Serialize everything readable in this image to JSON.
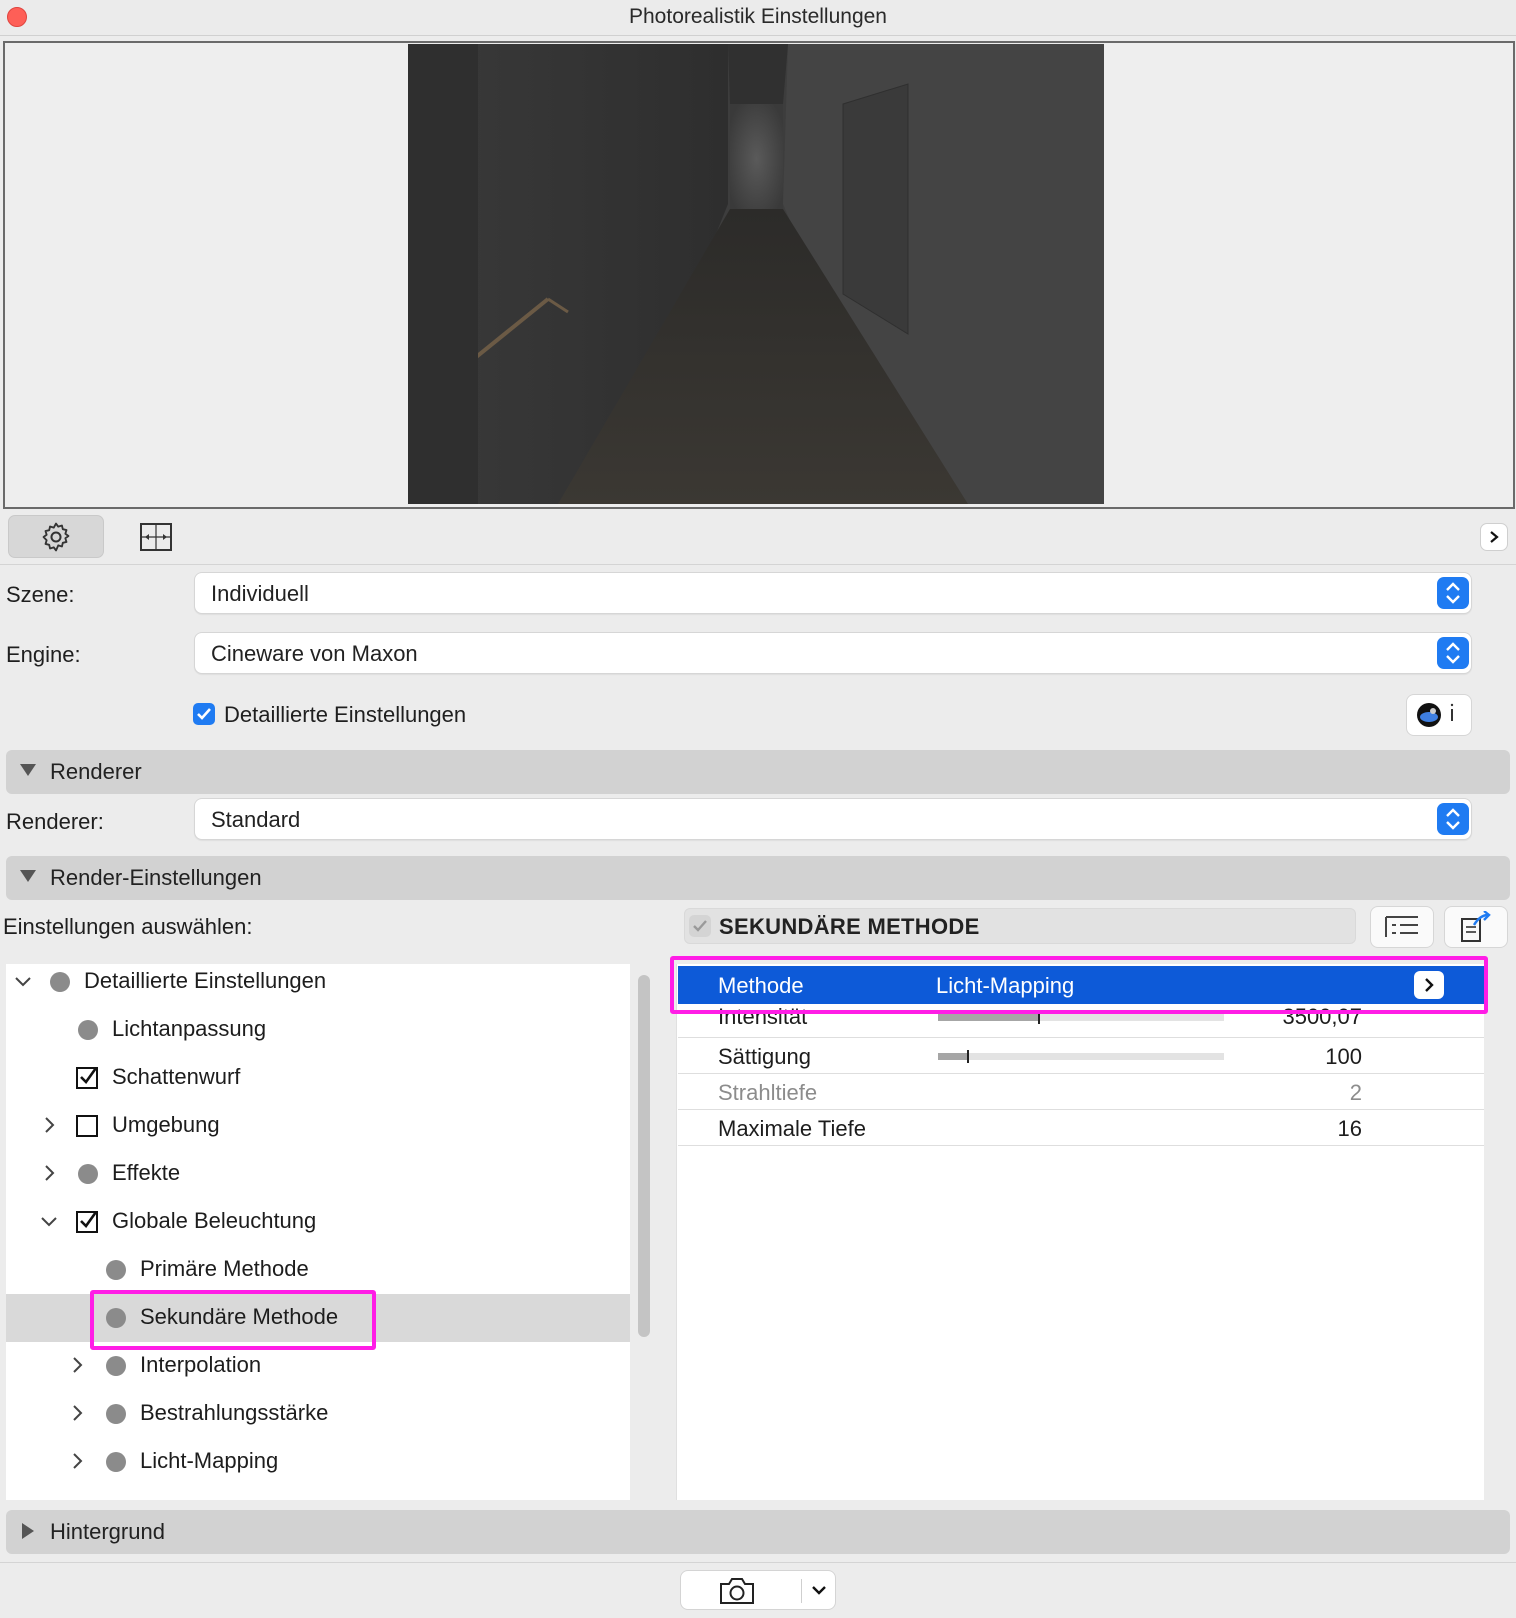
{
  "window": {
    "title": "Photorealistik Einstellungen"
  },
  "form": {
    "szene_label": "Szene:",
    "szene_value": "Individuell",
    "engine_label": "Engine:",
    "engine_value": "Cineware von Maxon",
    "detailed_label": "Detaillierte Einstellungen",
    "renderer_label": "Renderer:",
    "renderer_value": "Standard"
  },
  "sections": {
    "renderer": "Renderer",
    "render_settings": "Render-Einstellungen",
    "background": "Hintergrund"
  },
  "settings": {
    "select_label": "Einstellungen auswählen:"
  },
  "tree": {
    "items": [
      {
        "label": "Detaillierte Einstellungen"
      },
      {
        "label": "Lichtanpassung"
      },
      {
        "label": "Schattenwurf"
      },
      {
        "label": "Umgebung"
      },
      {
        "label": "Effekte"
      },
      {
        "label": "Globale Beleuchtung"
      },
      {
        "label": "Primäre Methode"
      },
      {
        "label": "Sekundäre Methode"
      },
      {
        "label": "Interpolation"
      },
      {
        "label": "Bestrahlungsstärke"
      },
      {
        "label": "Licht-Mapping"
      }
    ]
  },
  "params": {
    "header": "SEKUNDÄRE METHODE",
    "methode_name": "Methode",
    "methode_value": "Licht-Mapping",
    "rows": [
      {
        "name": "Intensität",
        "value": "3500,07",
        "slider": 0.35
      },
      {
        "name": "Sättigung",
        "value": "100",
        "slider": 0.1
      },
      {
        "name": "Strahltiefe",
        "value": "2"
      },
      {
        "name": "Maximale Tiefe",
        "value": "16"
      }
    ]
  },
  "colors": {
    "accent": "#1f7bf2",
    "selection": "#0d5ad8",
    "highlight": "#ff1de6"
  }
}
